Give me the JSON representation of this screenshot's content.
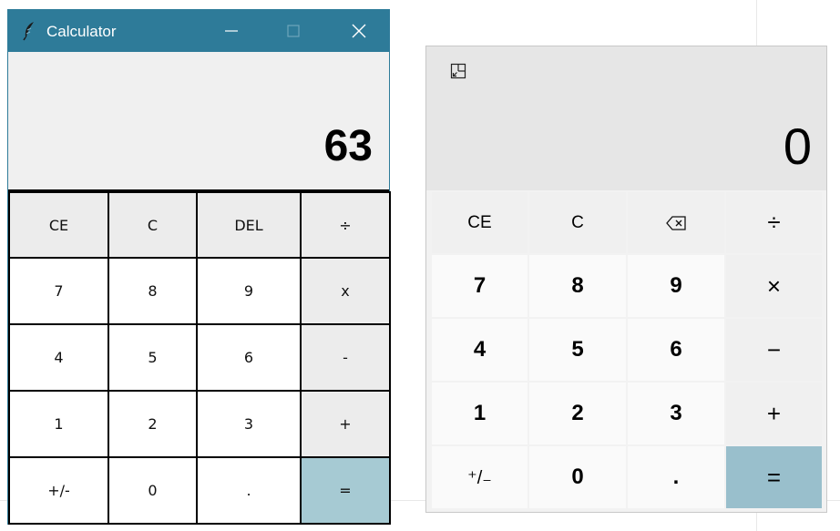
{
  "tk_calculator": {
    "title": "Calculator",
    "app_icon": "feather-icon",
    "window_controls": [
      "minimize-icon",
      "maximize-icon",
      "close-icon"
    ],
    "display": "63",
    "colors": {
      "titlebar": "#2e7b99",
      "equals": "#a6cad3",
      "operator": "#ececec"
    },
    "buttons": {
      "ce": "CE",
      "c": "C",
      "del": "DEL",
      "divide": "÷",
      "seven": "7",
      "eight": "8",
      "nine": "9",
      "multiply": "x",
      "four": "4",
      "five": "5",
      "six": "6",
      "minus": "-",
      "one": "1",
      "two": "2",
      "three": "3",
      "plus": "+",
      "negate": "+/-",
      "zero": "0",
      "dot": ".",
      "equals": "="
    }
  },
  "windows_calculator": {
    "mode_icon": "keep-on-top-icon",
    "display": "0",
    "colors": {
      "equals": "#99bfcc",
      "display_bg": "#e6e6e6"
    },
    "buttons": {
      "ce": "CE",
      "c": "C",
      "backspace": "backspace-icon",
      "divide": "÷",
      "seven": "7",
      "eight": "8",
      "nine": "9",
      "multiply": "×",
      "four": "4",
      "five": "5",
      "six": "6",
      "minus": "−",
      "one": "1",
      "two": "2",
      "three": "3",
      "plus": "+",
      "negate": "⁺/₋",
      "zero": "0",
      "dot": ".",
      "equals": "="
    }
  }
}
